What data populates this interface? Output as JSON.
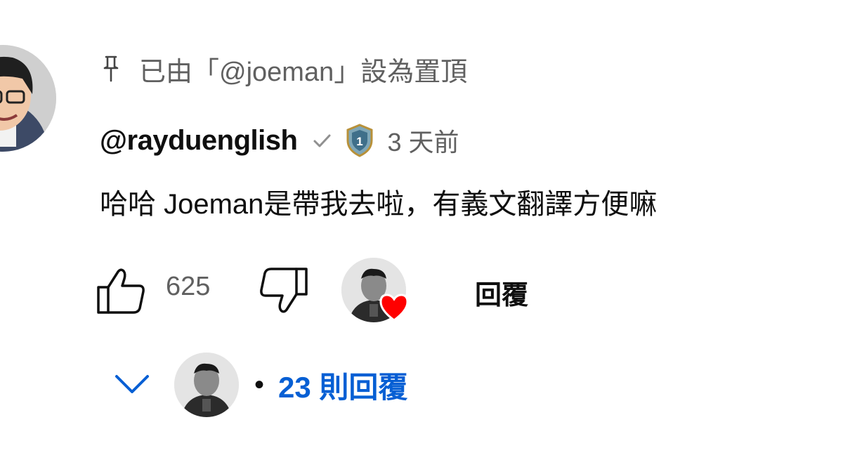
{
  "comment": {
    "pinned_text": "已由「@joeman」設為置頂",
    "pin_icon": "pin-icon",
    "author": "@rayduenglish",
    "verified_icon": "checkmark-icon",
    "member_badge_icon": "member-badge-icon",
    "timestamp": "3 天前",
    "text": "哈哈 Joeman是帶我去啦，有義文翻譯方便嘛",
    "like_count": "625",
    "reply_label": "回覆",
    "creator_heart_icon": "heart-icon",
    "replies_count_label": "23 則回覆",
    "replies_separator": "•"
  },
  "colors": {
    "text_primary": "#0f0f0f",
    "text_secondary": "#606060",
    "link_blue": "#065fd4",
    "heart_red": "#ff0000"
  }
}
